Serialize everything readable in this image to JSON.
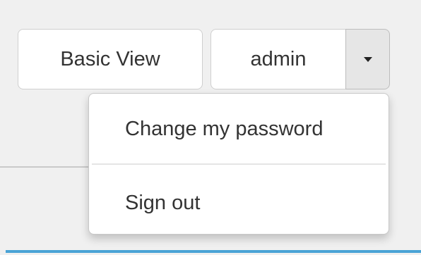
{
  "toolbar": {
    "basic_view_label": "Basic View",
    "user_label": "admin",
    "toggle_icon": "caret-down-icon"
  },
  "user_menu": {
    "items": [
      {
        "label": "Change my password"
      },
      {
        "label": "Sign out"
      }
    ]
  },
  "colors": {
    "background": "#f0f0f0",
    "accent_bar": "#4aa3d6",
    "text": "#333333"
  }
}
